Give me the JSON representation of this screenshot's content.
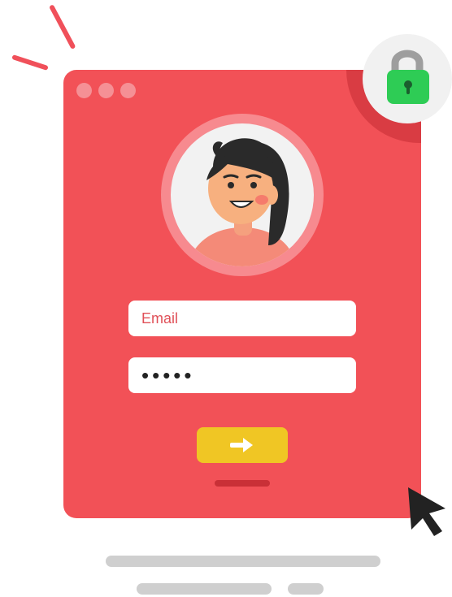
{
  "login": {
    "email_placeholder": "Email",
    "password_value": "•••••",
    "submit_icon": "arrow-right-icon"
  },
  "window": {
    "dots": [
      "window-dot",
      "window-dot",
      "window-dot"
    ]
  },
  "icons": {
    "lock": "lock-icon",
    "cursor": "cursor-icon",
    "avatar": "user-avatar"
  },
  "colors": {
    "window": "#f25157",
    "button": "#f0c624",
    "lock_body": "#2ecc55",
    "accent": "#f0505a"
  }
}
